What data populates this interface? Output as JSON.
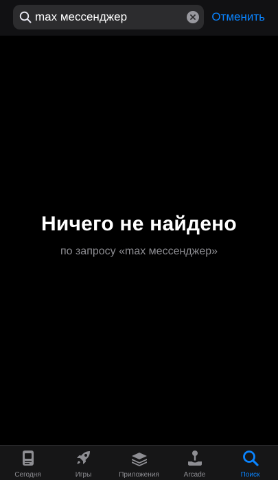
{
  "search": {
    "query": "max мессенджер",
    "cancel_label": "Отменить"
  },
  "empty_state": {
    "title": "Ничего не найдено",
    "subtitle": "по запросу «max мессенджер»"
  },
  "tab_bar": {
    "active_tab": "search",
    "items": [
      {
        "label": "Сегодня",
        "icon": "today-icon"
      },
      {
        "label": "Игры",
        "icon": "rocket-icon"
      },
      {
        "label": "Приложения",
        "icon": "apps-stack-icon"
      },
      {
        "label": "Arcade",
        "icon": "joystick-icon"
      },
      {
        "label": "Поиск",
        "icon": "search-icon"
      }
    ]
  },
  "colors": {
    "accent": "#0a84ff",
    "background": "#000000",
    "inactive": "#8e8e93"
  }
}
